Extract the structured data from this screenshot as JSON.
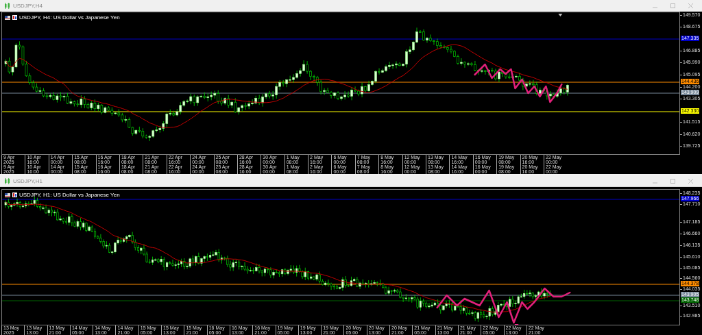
{
  "windows": [
    {
      "title": "USDJPY,H4",
      "legend": "USDJPY, H4: US Dollar vs Japanese Yen",
      "price_axis": [
        {
          "kind": "tick",
          "text": "149.570"
        },
        {
          "kind": "tick",
          "text": "148.675"
        },
        {
          "kind": "line_label",
          "text": "147.335",
          "color": "#0000c8"
        },
        {
          "kind": "tick",
          "text": "146.885"
        },
        {
          "kind": "tick",
          "text": "145.990"
        },
        {
          "kind": "tick",
          "text": "145.095"
        },
        {
          "kind": "line_label",
          "text": "144.436",
          "color": "#ff8c00"
        },
        {
          "kind": "tick",
          "text": "144.200"
        },
        {
          "kind": "line_label",
          "text": "143.909",
          "color": "#778899"
        },
        {
          "kind": "tick",
          "text": "143.305"
        },
        {
          "kind": "line_label",
          "text": "142.330",
          "color": "#ffff00"
        },
        {
          "kind": "tick",
          "text": "141.515"
        },
        {
          "kind": "tick",
          "text": "140.620"
        },
        {
          "kind": "tick",
          "text": "139.725"
        }
      ],
      "time_axis_rows": [
        [
          "9 Apr 2025",
          "10 Apr 16:00",
          "14 Apr 00:00",
          "15 Apr 08:00",
          "16 Apr 16:00",
          "18 Apr 08:00",
          "21 Apr 08:00",
          "22 Apr 16:00",
          "24 Apr 00:00",
          "25 Apr 08:00",
          "28 Apr 16:00",
          "30 Apr 00:00",
          "1 May 08:00",
          "2 May 16:00",
          "6 May 00:00",
          "7 May 08:00",
          "8 May 16:00",
          "12 May 00:00",
          "13 May 08:00",
          "14 May 16:00",
          "16 May 00:00",
          "19 May 08:00",
          "20 May 16:00",
          "22 May 00:00"
        ],
        [
          "9 Apr 2025",
          "10 Apr 16:00",
          "14 Apr 00:00",
          "15 Apr 08:00",
          "16 Apr 16:00",
          "18 Apr 08:00",
          "21 Apr 08:00",
          "22 Apr 16:00",
          "24 Apr 00:00",
          "25 Apr 08:00",
          "28 Apr 16:00",
          "30 Apr 00:00",
          "1 May 08:00",
          "2 May 16:00",
          "6 May 00:00",
          "7 May 08:00",
          "8 May 16:00",
          "12 May 00:00",
          "13 May 08:00",
          "14 May 16:00",
          "16 May 00:00",
          "19 May 08:00",
          "20 May 16:00",
          "22 May 00:00"
        ]
      ]
    },
    {
      "title": "USDJPY,H1",
      "legend": "USDJPY, H1: US Dollar vs Japanese Yen",
      "price_axis": [
        {
          "kind": "tick",
          "text": "148.235"
        },
        {
          "kind": "line_label",
          "text": "147.966",
          "color": "#0000c8"
        },
        {
          "kind": "tick",
          "text": "147.710"
        },
        {
          "kind": "tick",
          "text": "147.185"
        },
        {
          "kind": "tick",
          "text": "146.660"
        },
        {
          "kind": "tick",
          "text": "146.135"
        },
        {
          "kind": "tick",
          "text": "145.610"
        },
        {
          "kind": "tick",
          "text": "145.085"
        },
        {
          "kind": "tick",
          "text": "144.560"
        },
        {
          "kind": "line_label",
          "text": "144.378",
          "color": "#ff8c00"
        },
        {
          "kind": "tick",
          "text": "144.035"
        },
        {
          "kind": "line_label",
          "text": "143.905",
          "color": "#778899"
        },
        {
          "kind": "line_label",
          "text": "143.748",
          "color": "#006400"
        },
        {
          "kind": "tick",
          "text": "143.510"
        },
        {
          "kind": "tick",
          "text": "142.985"
        }
      ],
      "time_axis_rows": [
        [
          "13 May 2025",
          "13 May 13:00",
          "13 May 21:00",
          "14 May 05:00",
          "14 May 13:00",
          "14 May 21:00",
          "15 May 05:00",
          "15 May 13:00",
          "15 May 21:00",
          "16 May 05:00",
          "16 May 13:00",
          "16 May 21:00",
          "19 May 05:00",
          "19 May 13:00",
          "19 May 21:00",
          "20 May 05:00",
          "20 May 13:00",
          "20 May 21:00",
          "21 May 05:00",
          "21 May 13:00",
          "21 May 21:00",
          "22 May 05:00",
          "22 May 13:00",
          "22 May 21:00"
        ]
      ]
    }
  ]
}
